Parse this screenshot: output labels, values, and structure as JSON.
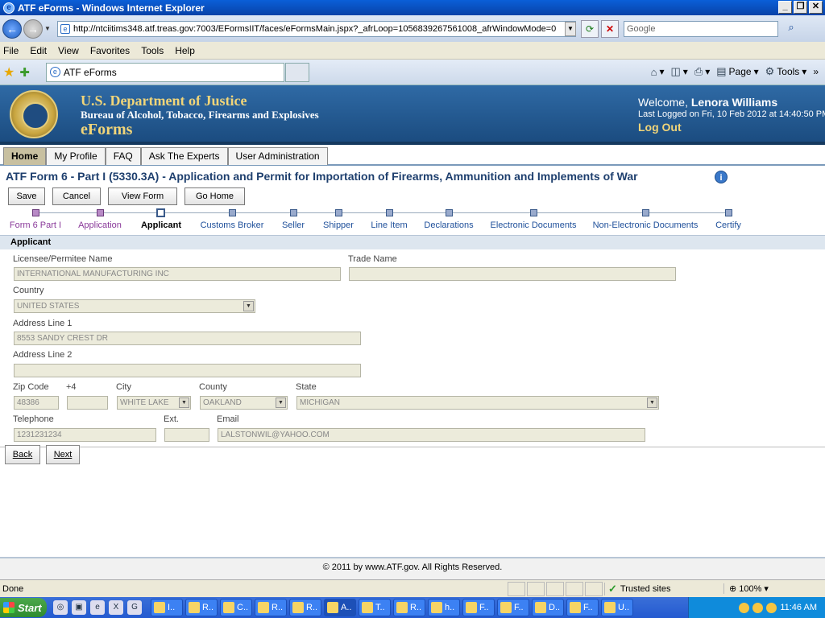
{
  "browser": {
    "title": "ATF eForms - Windows Internet Explorer",
    "url": "http://ntciitims348.atf.treas.gov:7003/EFormsIIT/faces/eFormsMain.jspx?_afrLoop=1056839267561008_afrWindowMode=0",
    "search_placeholder": "Google",
    "menu": [
      "File",
      "Edit",
      "View",
      "Favorites",
      "Tools",
      "Help"
    ],
    "tab_title": "ATF eForms",
    "cmd_page": "Page",
    "cmd_tools": "Tools",
    "status_text": "Done",
    "zone": "Trusted sites",
    "zoom": "100%"
  },
  "banner": {
    "department": "U.S. Department of Justice",
    "bureau": "Bureau of Alcohol, Tobacco, Firearms and Explosives",
    "app_name": "eForms",
    "welcome_prefix": "Welcome,",
    "user_name": "Lenora Williams",
    "last_logged": "Last Logged on Fri, 10 Feb 2012 at 14:40:50 PM",
    "logout": "Log Out"
  },
  "nav_tabs": [
    "Home",
    "My Profile",
    "FAQ",
    "Ask The Experts",
    "User Administration"
  ],
  "form_title": "ATF Form 6 - Part I (5330.3A) - Application and Permit for Importation of Firearms, Ammunition and Implements of War",
  "actions": {
    "save": "Save",
    "cancel": "Cancel",
    "view_form": "View Form",
    "go_home": "Go Home"
  },
  "train": [
    {
      "label": "Form 6 Part I",
      "state": "done"
    },
    {
      "label": "Application",
      "state": "done"
    },
    {
      "label": "Applicant",
      "state": "current"
    },
    {
      "label": "Customs Broker",
      "state": "todo"
    },
    {
      "label": "Seller",
      "state": "todo"
    },
    {
      "label": "Shipper",
      "state": "todo"
    },
    {
      "label": "Line Item",
      "state": "todo"
    },
    {
      "label": "Declarations",
      "state": "todo"
    },
    {
      "label": "Electronic Documents",
      "state": "todo"
    },
    {
      "label": "Non-Electronic Documents",
      "state": "todo"
    },
    {
      "label": "Certify",
      "state": "todo"
    }
  ],
  "section_title": "Applicant",
  "fields": {
    "licensee_label": "Licensee/Permitee Name",
    "licensee_value": "INTERNATIONAL MANUFACTURING INC",
    "trade_label": "Trade Name",
    "trade_value": "",
    "country_label": "Country",
    "country_value": "UNITED STATES",
    "addr1_label": "Address Line 1",
    "addr1_value": "8553 SANDY CREST DR",
    "addr2_label": "Address Line 2",
    "addr2_value": "",
    "zip_label": "Zip Code",
    "zip_value": "48386",
    "plus4_label": "+4",
    "plus4_value": "",
    "city_label": "City",
    "city_value": "WHITE LAKE",
    "county_label": "County",
    "county_value": "OAKLAND",
    "state_label": "State",
    "state_value": "MICHIGAN",
    "phone_label": "Telephone",
    "phone_value": "1231231234",
    "ext_label": "Ext.",
    "ext_value": "",
    "email_label": "Email",
    "email_value": "LALSTONWIL@YAHOO.COM"
  },
  "pager": {
    "back": "Back",
    "next": "Next"
  },
  "footer": "© 2011 by www.ATF.gov. All Rights Reserved.",
  "taskbar": {
    "start": "Start",
    "tasks": [
      "I..",
      "R..",
      "C..",
      "R..",
      "R..",
      "A..",
      "T..",
      "R..",
      "h..",
      "F..",
      "F..",
      "D..",
      "F..",
      "U.."
    ],
    "clock": "11:46 AM"
  }
}
